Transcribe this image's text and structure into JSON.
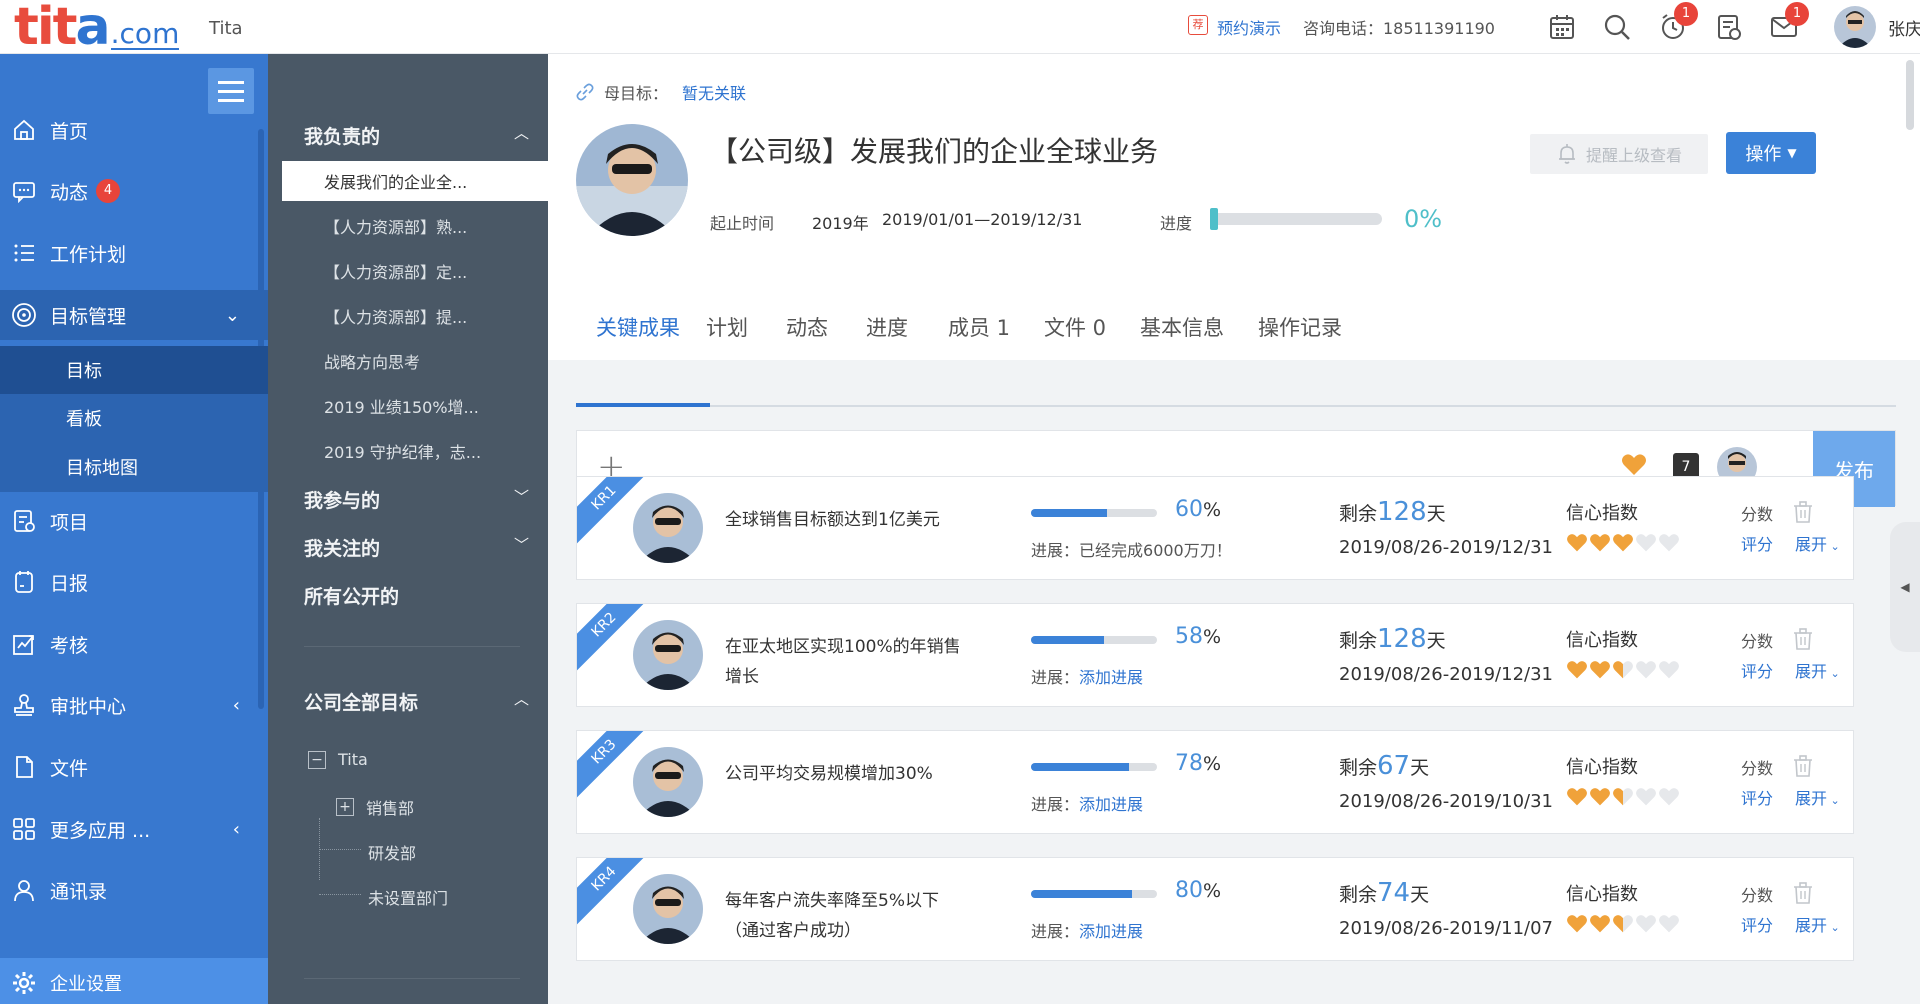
{
  "topbar": {
    "logo_text_1": "tit",
    "logo_text_2": "a",
    "logo_suffix": ".com",
    "app_name": "Tita",
    "rec_badge": "荐",
    "demo_link": "预约演示",
    "hotline": "咨询电话：18511391190",
    "todo_badge": "1",
    "mail_badge": "1",
    "user_name": "张庆"
  },
  "leftnav": {
    "items": [
      {
        "label": "首页",
        "icon": "home-icon"
      },
      {
        "label": "动态",
        "icon": "message-icon",
        "badge": "4"
      },
      {
        "label": "工作计划",
        "icon": "list-icon"
      },
      {
        "label": "目标管理",
        "icon": "target-icon",
        "chevron": "⌄"
      },
      {
        "label": "项目",
        "icon": "project-icon"
      },
      {
        "label": "日报",
        "icon": "report-icon"
      },
      {
        "label": "考核",
        "icon": "chart-icon"
      },
      {
        "label": "审批中心",
        "icon": "stamp-icon",
        "chevron": "‹"
      },
      {
        "label": "文件",
        "icon": "file-icon"
      },
      {
        "label": "更多应用 ...",
        "icon": "grid-icon",
        "chevron": "‹"
      },
      {
        "label": "通讯录",
        "icon": "contact-icon"
      }
    ],
    "subitems": [
      "目标",
      "看板",
      "目标地图"
    ],
    "bottom": "企业设置"
  },
  "panel": {
    "mine_title": "我负责的",
    "mine_items": [
      "发展我们的企业全...",
      "【人力资源部】熟...",
      "【人力资源部】定...",
      "【人力资源部】提...",
      "战略方向思考",
      "2019 业绩150%增...",
      "2019 守护纪律，志..."
    ],
    "joined": "我参与的",
    "followed": "我关注的",
    "public": "所有公开的",
    "company_title": "公司全部目标",
    "tree": {
      "root": "Tita",
      "sales": "销售部",
      "rd": "研发部",
      "none": "未设置部门"
    }
  },
  "header": {
    "parent_label": "母目标：",
    "parent_value": "暂无关联",
    "title": "【公司级】发展我们的企业全球业务",
    "date_label": "起止时间",
    "year": "2019年",
    "range": "2019/01/01—2019/12/31",
    "progress_label": "进度",
    "progress_value": "0%",
    "progress_fraction": 0,
    "remind": "提醒上级查看",
    "operate": "操作"
  },
  "tabs": [
    "关键成果",
    "计划",
    "动态",
    "进度",
    "成员 1",
    "文件 0",
    "基本信息",
    "操作记录"
  ],
  "composer": {
    "plus": "+",
    "calendar_day": "7",
    "publish": "发布"
  },
  "kr_labels": {
    "progress_prefix": "进展：",
    "remain": "剩余",
    "days": "天",
    "confidence": "信心指数",
    "score": "分数",
    "rate": "评分",
    "expand": "展开"
  },
  "krs": [
    {
      "tag": "KR1",
      "title": "全球销售目标额达到1亿美元",
      "percent": "60",
      "note": "已经完成6000万刀！",
      "note_is_link": false,
      "remain": "128",
      "dates": "2019/08/26-2019/12/31",
      "confidence": 3
    },
    {
      "tag": "KR2",
      "title": "在亚太地区实现100%的年销售增长",
      "percent": "58",
      "note": "添加进展",
      "note_is_link": true,
      "remain": "128",
      "dates": "2019/08/26-2019/12/31",
      "confidence": 2.5
    },
    {
      "tag": "KR3",
      "title": "公司平均交易规模增加30%",
      "percent": "78",
      "note": "添加进展",
      "note_is_link": true,
      "remain": "67",
      "dates": "2019/08/26-2019/10/31",
      "confidence": 2.5
    },
    {
      "tag": "KR4",
      "title": "每年客户流失率降至5%以下（通过客户成功）",
      "percent": "80",
      "note": "添加进展",
      "note_is_link": true,
      "remain": "74",
      "dates": "2019/08/26-2019/11/07",
      "confidence": 2.5
    }
  ],
  "colors": {
    "accent": "#2f74d0",
    "nav": "#3878cf",
    "panel": "#4a5866",
    "heart": "#f0a23a",
    "teal": "#4fbfc9"
  }
}
